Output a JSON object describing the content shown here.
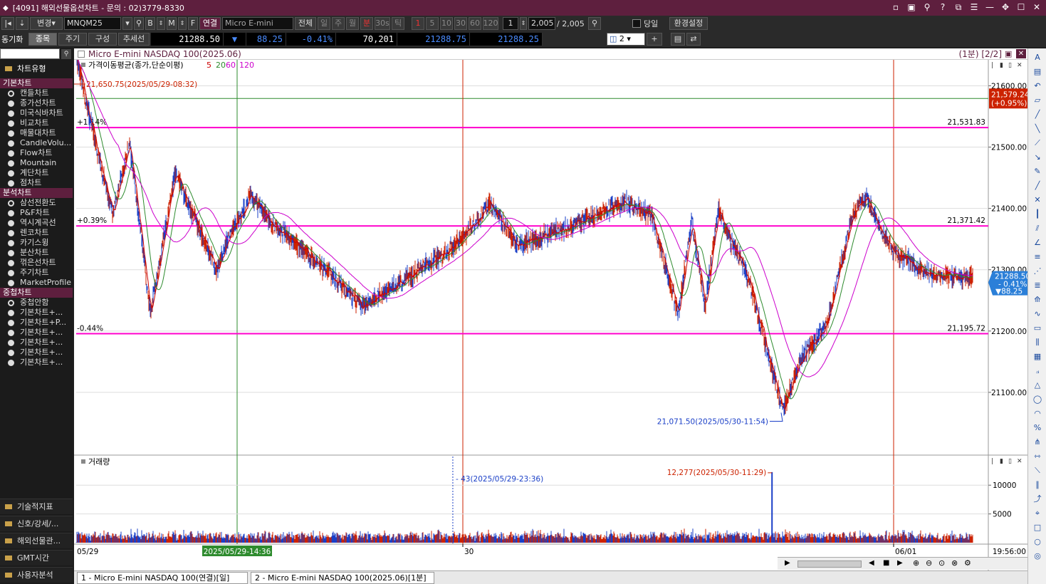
{
  "window": {
    "title": "[4091] 해외선물옵션차트 - 문의 : 02)3779-8330"
  },
  "toolbar": {
    "change_label": "변경",
    "symbol": "MNQM25",
    "b_label": "B",
    "m_label": "M",
    "f_label": "F",
    "link_label": "연결",
    "product_name": "Micro E-mini NAS",
    "all_label": "전체",
    "periods": [
      "일",
      "주",
      "월",
      "분",
      "30s",
      "틱"
    ],
    "active_period": "분",
    "intervals": [
      "1",
      "5",
      "10",
      "30",
      "60",
      "120"
    ],
    "active_interval": "1",
    "interval_input": "1",
    "count_value": "2,005",
    "count_total": "/ 2,005",
    "today_label": "당일",
    "settings_label": "환경설정",
    "sync_label": "동기화",
    "item_tab": "종목",
    "period_tab": "주기",
    "composition_tab": "구성",
    "trend_tab": "추세선",
    "split_count": "2",
    "quote": {
      "price": "21288.50",
      "arrow": "▼",
      "change": "88.25",
      "change_pct": "-0.41%",
      "volume": "70,201",
      "ask": "21288.75",
      "bid": "21288.25"
    }
  },
  "left_panel": {
    "header": "차트유형",
    "sections": [
      {
        "title": "기본차트",
        "items": [
          "캔들차트",
          "종가선차트",
          "미국식바차트",
          "비교차트",
          "매물대차트",
          "CandleVolu...",
          "Flow차트",
          "Mountain",
          "계단차트",
          "점차트"
        ]
      },
      {
        "title": "분석차트",
        "items": [
          "삼선전환도",
          "P&F차트",
          "역시계곡선",
          "렌코차트",
          "카기스윙",
          "분산차트",
          "꺾은선차트",
          "주기차트",
          "MarketProfile"
        ]
      },
      {
        "title": "중첩차트",
        "items": [
          "중첩안함",
          "기본차트+...",
          "기본차트+P...",
          "기본차트+...",
          "기본차트+...",
          "기본차트+...",
          "기본차트+..."
        ]
      }
    ],
    "bottom_items": [
      "기술적지표",
      "신호/강세/...",
      "해외선물관...",
      "GMT시간",
      "사용자분석"
    ]
  },
  "chart": {
    "title": "Micro E-mini NASDAQ 100(2025.06)",
    "period_badge": "(1분) [2/2]",
    "indicator_label": "가격이동평균(종가,단순이평)",
    "ma_periods": [
      "5",
      "20",
      "60",
      "120"
    ],
    "ma_colors": [
      "#cc0000",
      "#2e8b2e",
      "#cc00cc",
      "#cc00cc"
    ],
    "high_annotation": "21,650.75(2025/05/29-08:32)",
    "low_annotation": "21,071.50(2025/05/30-11:54)",
    "price_axis": [
      "21600.00",
      "21500.00",
      "21400.00",
      "21300.00",
      "21200.00",
      "21100.00"
    ],
    "hlines": [
      {
        "pct": "+1.14%",
        "value": "21,531.83",
        "price": 21531.83
      },
      {
        "pct": "+0.39%",
        "value": "21,371.42",
        "price": 21371.42
      },
      {
        "pct": "-0.44%",
        "value": "21,195.72",
        "price": 21195.72
      }
    ],
    "reference_line_price": 21579.24,
    "current_tag": {
      "price": "21288.50",
      "pct": "- 0.41%",
      "change": "▼88.25"
    },
    "reference_tag": {
      "price": "21,579.24",
      "pct": "(+0.95%)"
    },
    "volume_label": "거래량",
    "volume_axis": [
      "10000",
      "5000"
    ],
    "volume_max_annotation": "12,277(2025/05/30-11:29)",
    "volume_min_annotation": "43(2025/05/29-23:36)",
    "x_labels": [
      "05/29",
      "30",
      "06/01",
      "19:56:00"
    ],
    "crosshair_time": "2025/05/29-14:36",
    "colors": {
      "up": "#cc2200",
      "down": "#1a3fc7",
      "hline": "#ff00cc",
      "brand": "#5e1f3e"
    }
  },
  "chart_data": {
    "type": "candlestick",
    "title": "Micro E-mini NASDAQ 100(2025.06)",
    "interval": "1분",
    "ylim": [
      21050,
      21660
    ],
    "y_ticks": [
      21100,
      21200,
      21300,
      21400,
      21500,
      21600
    ],
    "price_path": [
      {
        "t": "05/29 08:32",
        "price": 21650
      },
      {
        "t": "05/29 09:30",
        "price": 21470
      },
      {
        "t": "05/29 10:00",
        "price": 21390
      },
      {
        "t": "05/29 10:40",
        "price": 21510
      },
      {
        "t": "05/29 11:30",
        "price": 21230
      },
      {
        "t": "05/29 12:30",
        "price": 21460
      },
      {
        "t": "05/29 13:30",
        "price": 21360
      },
      {
        "t": "05/29 14:10",
        "price": 21300
      },
      {
        "t": "05/29 14:36",
        "price": 21350
      },
      {
        "t": "05/29 15:30",
        "price": 21420
      },
      {
        "t": "05/29 16:30",
        "price": 21370
      },
      {
        "t": "05/29 18:30",
        "price": 21300
      },
      {
        "t": "05/29 20:00",
        "price": 21240
      },
      {
        "t": "05/29 23:00",
        "price": 21320
      },
      {
        "t": "05/30 00:00",
        "price": 21350
      },
      {
        "t": "05/30 01:00",
        "price": 21410
      },
      {
        "t": "05/30 02:00",
        "price": 21340
      },
      {
        "t": "05/30 04:00",
        "price": 21370
      },
      {
        "t": "05/30 06:00",
        "price": 21410
      },
      {
        "t": "05/30 07:00",
        "price": 21390
      },
      {
        "t": "05/30 08:00",
        "price": 21230
      },
      {
        "t": "05/30 08:30",
        "price": 21380
      },
      {
        "t": "05/30 09:00",
        "price": 21240
      },
      {
        "t": "05/30 09:30",
        "price": 21400
      },
      {
        "t": "05/30 10:00",
        "price": 21340
      },
      {
        "t": "05/30 10:30",
        "price": 21300
      },
      {
        "t": "05/30 11:54",
        "price": 21071.5
      },
      {
        "t": "05/30 12:30",
        "price": 21150
      },
      {
        "t": "05/30 13:30",
        "price": 21210
      },
      {
        "t": "05/30 14:30",
        "price": 21390
      },
      {
        "t": "05/30 15:00",
        "price": 21420
      },
      {
        "t": "05/30 15:30",
        "price": 21370
      },
      {
        "t": "06/01 18:00",
        "price": 21330
      },
      {
        "t": "06/01 19:00",
        "price": 21290
      },
      {
        "t": "06/01 19:56",
        "price": 21288.5
      }
    ],
    "high": {
      "price": 21650.75,
      "time": "2025/05/29-08:32"
    },
    "low": {
      "price": 21071.5,
      "time": "2025/05/30-11:54"
    },
    "volume": {
      "ylim": [
        0,
        13000
      ],
      "y_ticks": [
        5000,
        10000
      ],
      "max": {
        "value": 12277,
        "time": "2025/05/30-11:29"
      },
      "min": {
        "value": 43,
        "time": "2025/05/29-23:36"
      }
    }
  }
}
